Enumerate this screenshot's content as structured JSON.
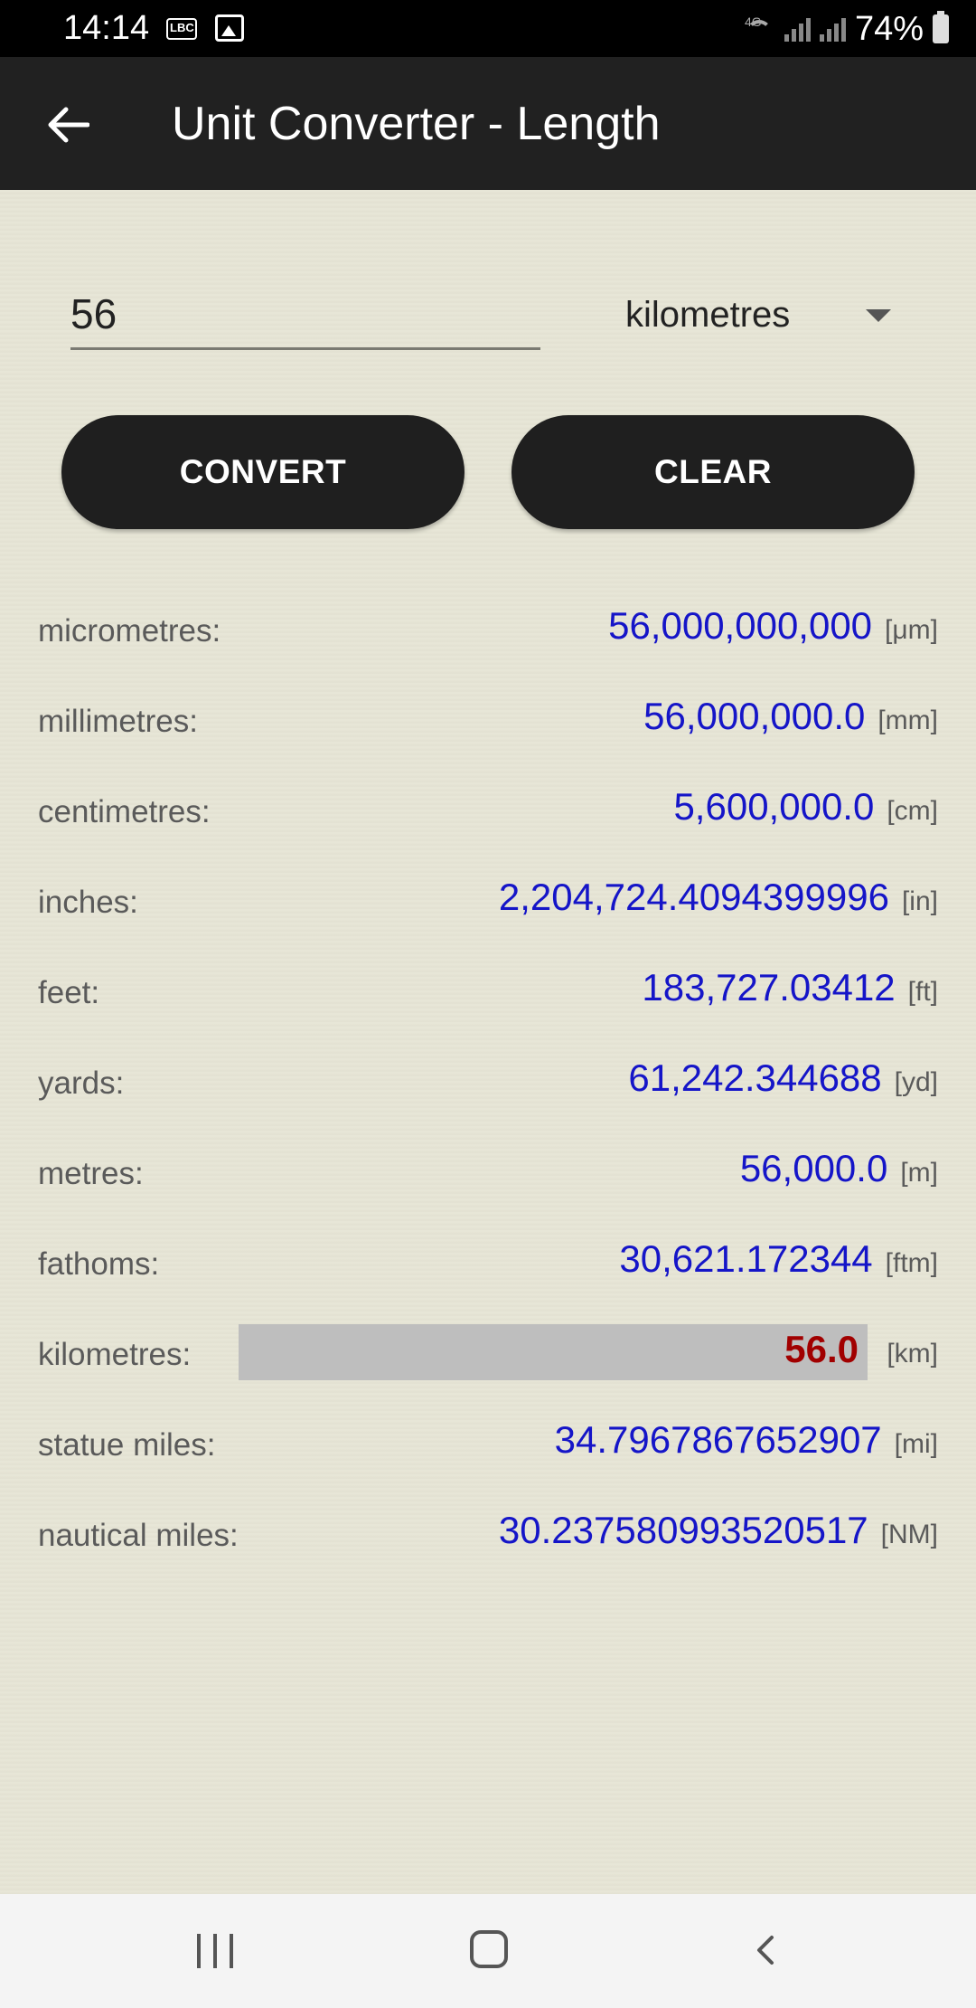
{
  "status_bar": {
    "time": "14:14",
    "battery": "74%",
    "network_label": "4G"
  },
  "app_bar": {
    "title": "Unit Converter - Length",
    "back_icon": "arrow-left-icon"
  },
  "input": {
    "value": "56",
    "selected_unit": "kilometres"
  },
  "buttons": {
    "convert": "CONVERT",
    "clear": "CLEAR"
  },
  "results": [
    {
      "label": "micrometres:",
      "value": "56,000,000,000",
      "unit": "[μm]",
      "highlight": false
    },
    {
      "label": "millimetres:",
      "value": "56,000,000.0",
      "unit": "[mm]",
      "highlight": false
    },
    {
      "label": "centimetres:",
      "value": "5,600,000.0",
      "unit": "[cm]",
      "highlight": false
    },
    {
      "label": "inches:",
      "value": "2,204,724.4094399996",
      "unit": "[in]",
      "highlight": false
    },
    {
      "label": "feet:",
      "value": "183,727.03412",
      "unit": "[ft]",
      "highlight": false
    },
    {
      "label": "yards:",
      "value": "61,242.344688",
      "unit": "[yd]",
      "highlight": false
    },
    {
      "label": "metres:",
      "value": "56,000.0",
      "unit": "[m]",
      "highlight": false
    },
    {
      "label": "fathoms:",
      "value": "30,621.172344",
      "unit": "[ftm]",
      "highlight": false
    },
    {
      "label": "kilometres:",
      "value": "56.0",
      "unit": "[km]",
      "highlight": true
    },
    {
      "label": "statue miles:",
      "value": "34.7967867652907",
      "unit": "[mi]",
      "highlight": false
    },
    {
      "label": "nautical miles:",
      "value": "30.237580993520517",
      "unit": "[NM]",
      "highlight": false
    }
  ],
  "colors": {
    "background": "#e7e6d6",
    "app_bar": "#212121",
    "value_text": "#1515c8",
    "highlight_text": "#a10000",
    "highlight_box": "#bebebe"
  }
}
